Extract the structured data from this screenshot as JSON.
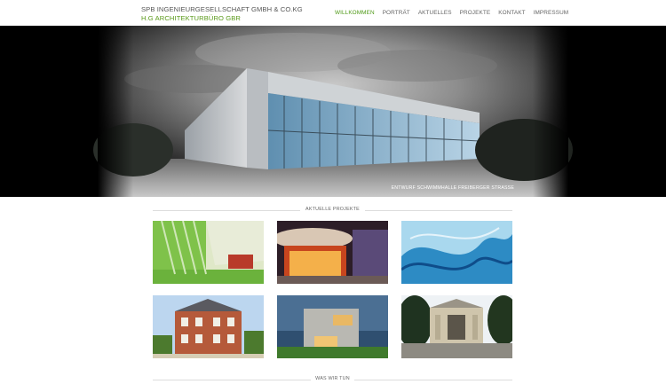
{
  "header": {
    "logo_line1": "SPB INGENIEURGESELLSCHAFT GMBH & CO.KG",
    "logo_line2": "H.G ARCHITEKTURBÜRO GBR"
  },
  "nav": {
    "items": [
      {
        "label": "WILLKOMMEN",
        "active": true
      },
      {
        "label": "PORTRÄT",
        "active": false
      },
      {
        "label": "AKTUELLES",
        "active": false
      },
      {
        "label": "PROJEKTE",
        "active": false
      },
      {
        "label": "KONTAKT",
        "active": false
      },
      {
        "label": "IMPRESSUM",
        "active": false
      }
    ]
  },
  "hero": {
    "caption": "ENTWURF SCHWIMMHALLE FREIBERGER STRASSE"
  },
  "projects": {
    "heading": "AKTUELLE PROJEKTE",
    "items": [
      {
        "subject": "green-interior-hall"
      },
      {
        "subject": "illuminated-shop-front"
      },
      {
        "subject": "blue-abstract-painting"
      },
      {
        "subject": "historic-brick-villa"
      },
      {
        "subject": "modern-concrete-cube-house"
      },
      {
        "subject": "classical-pavilion"
      }
    ]
  },
  "services": {
    "heading": "WAS WIR TUN"
  },
  "colors": {
    "accent": "#4f9a17",
    "text": "#555555",
    "hero_bg": "#000000"
  }
}
